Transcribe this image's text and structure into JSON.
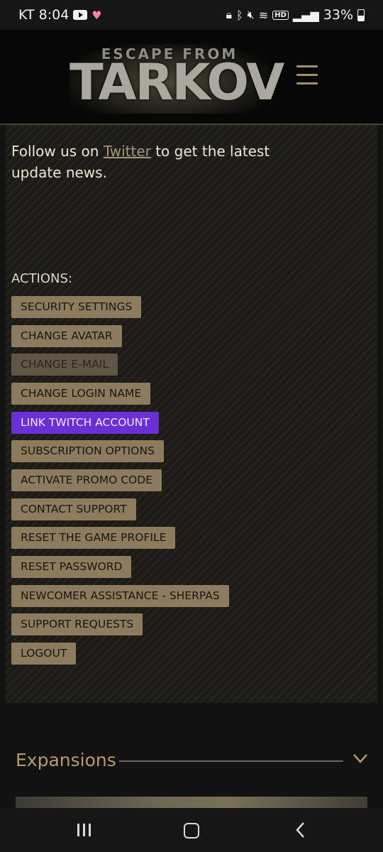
{
  "status_bar": {
    "carrier_time": "KT 8:04",
    "battery": "33%",
    "hd_label": "HD",
    "icons": [
      "youtube-icon",
      "heart-icon",
      "lock-icon",
      "bluetooth-icon",
      "mute-icon",
      "wifi-icon",
      "hd-icon",
      "signal-icon",
      "battery-icon"
    ]
  },
  "header": {
    "logo_top": "ESCAPE FROM",
    "logo_main": "TARKOV",
    "menu_icon": "hamburger-menu-icon"
  },
  "notice": {
    "before": "Follow us on ",
    "link": "Twitter",
    "after": " to get the latest update news."
  },
  "actions": {
    "label": "ACTIONS:",
    "items": [
      {
        "label": "SECURITY SETTINGS"
      },
      {
        "label": "CHANGE AVATAR"
      },
      {
        "label": "CHANGE E-MAIL"
      },
      {
        "label": "CHANGE LOGIN NAME"
      },
      {
        "label": "LINK TWITCH ACCOUNT"
      },
      {
        "label": "SUBSCRIPTION OPTIONS"
      },
      {
        "label": "ACTIVATE PROMO CODE"
      },
      {
        "label": "CONTACT SUPPORT"
      },
      {
        "label": "RESET THE GAME PROFILE"
      },
      {
        "label": "RESET PASSWORD"
      },
      {
        "label": "NEWCOMER ASSISTANCE - SHERPAS"
      },
      {
        "label": "SUPPORT REQUESTS"
      },
      {
        "label": "LOGOUT"
      }
    ]
  },
  "expansions": {
    "title": "Expansions"
  },
  "colors": {
    "accent": "#8c7b5c",
    "twitch": "#6b2fd6",
    "gold_text": "#b39c70"
  }
}
